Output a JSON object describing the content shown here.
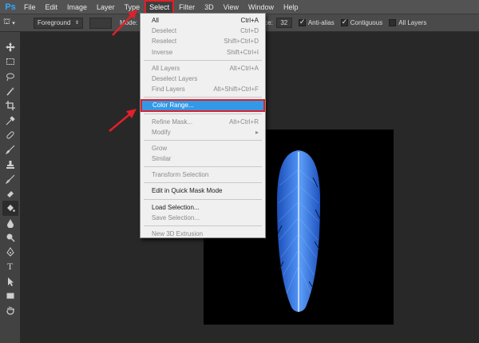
{
  "app": {
    "logo": "Ps"
  },
  "menubar": {
    "items": [
      {
        "label": "File"
      },
      {
        "label": "Edit"
      },
      {
        "label": "Image"
      },
      {
        "label": "Layer"
      },
      {
        "label": "Type"
      },
      {
        "label": "Select"
      },
      {
        "label": "Filter"
      },
      {
        "label": "3D"
      },
      {
        "label": "View"
      },
      {
        "label": "Window"
      },
      {
        "label": "Help"
      }
    ]
  },
  "options": {
    "fill_source": "Foreground",
    "mode_label": "Mode:",
    "tolerance_label": "ance:",
    "tolerance_value": "32",
    "anti_alias_label": "Anti-alias",
    "contiguous_label": "Contiguous",
    "all_layers_label": "All Layers"
  },
  "select_menu": {
    "items": [
      {
        "label": "All",
        "shortcut": "Ctrl+A",
        "enabled": true
      },
      {
        "label": "Deselect",
        "shortcut": "Ctrl+D",
        "enabled": false
      },
      {
        "label": "Reselect",
        "shortcut": "Shift+Ctrl+D",
        "enabled": false
      },
      {
        "label": "Inverse",
        "shortcut": "Shift+Ctrl+I",
        "enabled": false
      },
      {
        "label": "All Layers",
        "shortcut": "Alt+Ctrl+A",
        "enabled": false
      },
      {
        "label": "Deselect Layers",
        "shortcut": "",
        "enabled": false
      },
      {
        "label": "Find Layers",
        "shortcut": "Alt+Shift+Ctrl+F",
        "enabled": false
      },
      {
        "label": "Color Range...",
        "shortcut": "",
        "enabled": true
      },
      {
        "label": "Refine Mask...",
        "shortcut": "Alt+Ctrl+R",
        "enabled": false
      },
      {
        "label": "Modify",
        "shortcut": "",
        "enabled": false
      },
      {
        "label": "Grow",
        "shortcut": "",
        "enabled": false
      },
      {
        "label": "Similar",
        "shortcut": "",
        "enabled": false
      },
      {
        "label": "Transform Selection",
        "shortcut": "",
        "enabled": false
      },
      {
        "label": "Edit in Quick Mask Mode",
        "shortcut": "",
        "enabled": true
      },
      {
        "label": "Load Selection...",
        "shortcut": "",
        "enabled": true
      },
      {
        "label": "Save Selection...",
        "shortcut": "",
        "enabled": false
      },
      {
        "label": "New 3D Extrusion",
        "shortcut": "",
        "enabled": false
      }
    ]
  },
  "colors": {
    "highlight": "#3399e6",
    "annotation_red": "#e0202a",
    "feather_blue": "#2f6fe0"
  }
}
